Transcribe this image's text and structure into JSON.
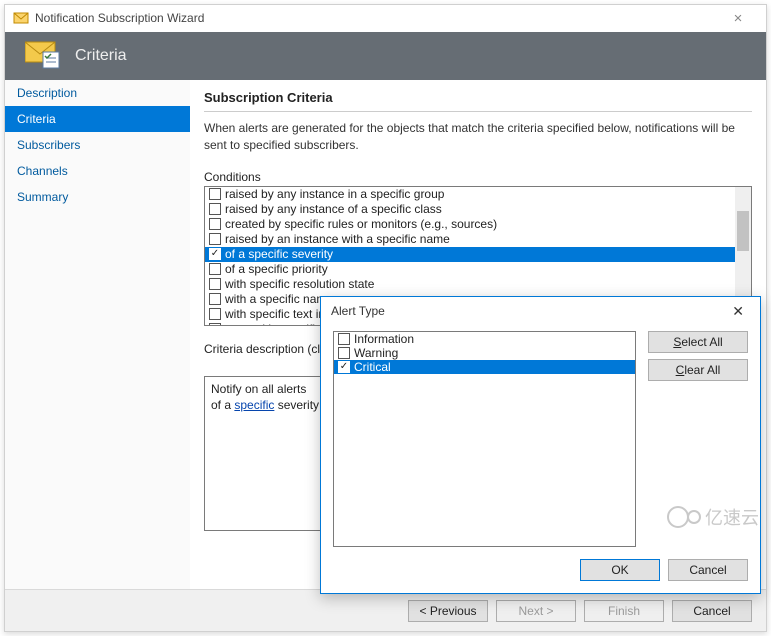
{
  "window": {
    "title": "Notification Subscription Wizard",
    "banner_title": "Criteria"
  },
  "nav": {
    "items": [
      {
        "label": "Description"
      },
      {
        "label": "Criteria"
      },
      {
        "label": "Subscribers"
      },
      {
        "label": "Channels"
      },
      {
        "label": "Summary"
      }
    ]
  },
  "content": {
    "section_title": "Subscription Criteria",
    "section_sub": "When alerts are generated for the objects that match the criteria specified below, notifications will be sent to specified subscribers.",
    "conditions_label": "Conditions",
    "conditions": [
      {
        "label": "raised by any instance in a specific group",
        "checked": false
      },
      {
        "label": "raised by any instance of a specific class",
        "checked": false
      },
      {
        "label": "created by specific rules or monitors (e.g., sources)",
        "checked": false
      },
      {
        "label": "raised by an instance with a specific name",
        "checked": false
      },
      {
        "label": "of a specific severity",
        "checked": true
      },
      {
        "label": "of a specific priority",
        "checked": false
      },
      {
        "label": "with specific resolution state",
        "checked": false
      },
      {
        "label": "with a specific name",
        "checked": false
      },
      {
        "label": "with specific text in the description",
        "checked": false
      },
      {
        "label": "created in specific time period",
        "checked": false
      }
    ],
    "desc_label": "Criteria description (click the underlined value to edit):",
    "desc_line1": "Notify on all alerts",
    "desc_line2_prefix": "of a ",
    "desc_line2_link": "specific",
    "desc_line2_suffix": " severity"
  },
  "footer": {
    "previous": "< Previous",
    "next": "Next >",
    "finish": "Finish",
    "cancel": "Cancel"
  },
  "modal": {
    "title": "Alert Type",
    "options": [
      {
        "label": "Information",
        "checked": false
      },
      {
        "label": "Warning",
        "checked": false
      },
      {
        "label": "Critical",
        "checked": true
      }
    ],
    "select_all_u": "S",
    "select_all_rest": "elect All",
    "clear_all_u": "C",
    "clear_all_rest": "lear All",
    "ok": "OK",
    "cancel": "Cancel"
  },
  "watermark": "亿速云"
}
